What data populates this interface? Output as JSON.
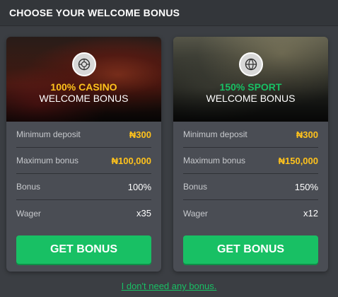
{
  "header": {
    "title": "CHOOSE YOUR WELCOME BONUS"
  },
  "cards": [
    {
      "headline": "100% CASINO",
      "headline_color": "#ffc21c",
      "subtitle": "WELCOME BONUS",
      "icon": "roulette-chip-icon",
      "rows": [
        {
          "label": "Minimum deposit",
          "value": "₦300"
        },
        {
          "label": "Maximum bonus",
          "value": "₦100,000"
        },
        {
          "label": "Bonus",
          "value": "100%"
        },
        {
          "label": "Wager",
          "value": "x35"
        }
      ],
      "cta_label": "GET BONUS"
    },
    {
      "headline": "150% SPORT",
      "headline_color": "#18c064",
      "subtitle": "WELCOME BONUS",
      "icon": "basketball-icon",
      "rows": [
        {
          "label": "Minimum deposit",
          "value": "₦300"
        },
        {
          "label": "Maximum bonus",
          "value": "₦150,000"
        },
        {
          "label": "Bonus",
          "value": "150%"
        },
        {
          "label": "Wager",
          "value": "x12"
        }
      ],
      "cta_label": "GET BONUS"
    }
  ],
  "footer": {
    "decline_link": "I don't need any bonus."
  },
  "colors": {
    "accent_green": "#18c064",
    "gold": "#ffc21c",
    "background": "#3b3e43",
    "card": "#4a4d54"
  }
}
